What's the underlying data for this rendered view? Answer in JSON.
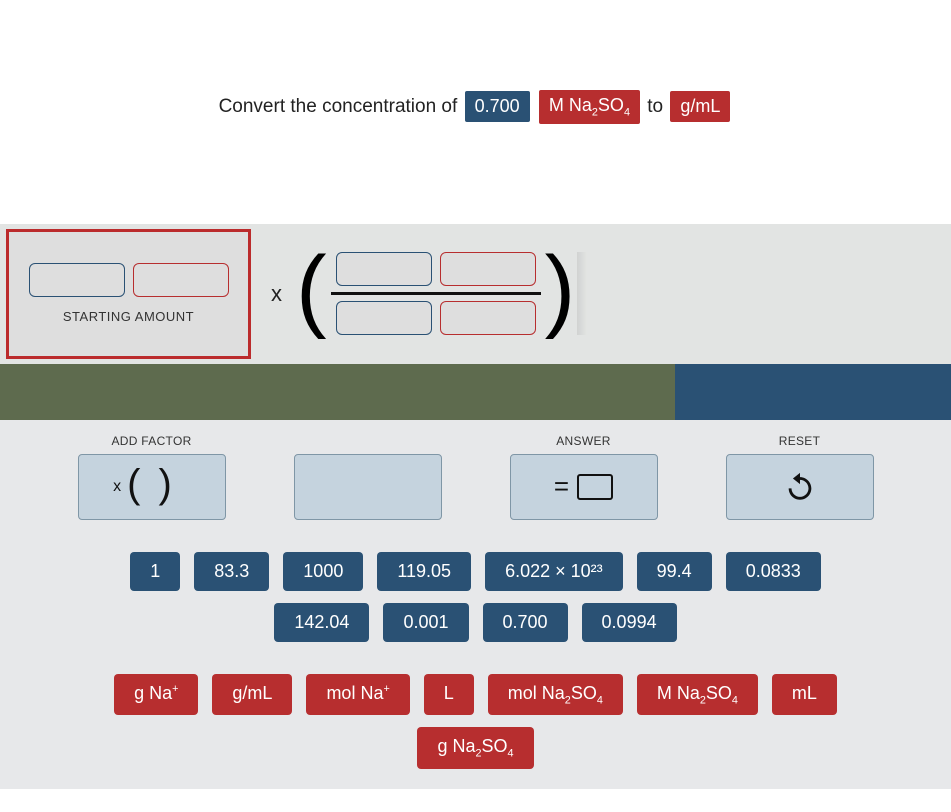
{
  "prompt": {
    "pre": "Convert the concentration of",
    "value_badge": "0.700",
    "compound_badge_html": "M Na<sub>2</sub>SO<sub>4</sub>",
    "mid": "to",
    "target_badge": "g/mL"
  },
  "starting_label": "STARTING AMOUNT",
  "controls": {
    "add_factor": "ADD FACTOR",
    "answer": "ANSWER",
    "reset": "RESET"
  },
  "number_tiles_row1": [
    "1",
    "83.3",
    "1000",
    "119.05",
    "6.022 × 10²³",
    "99.4",
    "0.0833"
  ],
  "number_tiles_row2": [
    "142.04",
    "0.001",
    "0.700",
    "0.0994"
  ],
  "unit_tiles_row1_html": [
    "g Na<sup>+</sup>",
    "g/mL",
    "mol Na<sup>+</sup>",
    "L",
    "mol Na<sub>2</sub>SO<sub>4</sub>",
    "M Na<sub>2</sub>SO<sub>4</sub>",
    "mL"
  ],
  "unit_tiles_row2_html": [
    "g Na<sub>2</sub>SO<sub>4</sub>"
  ]
}
